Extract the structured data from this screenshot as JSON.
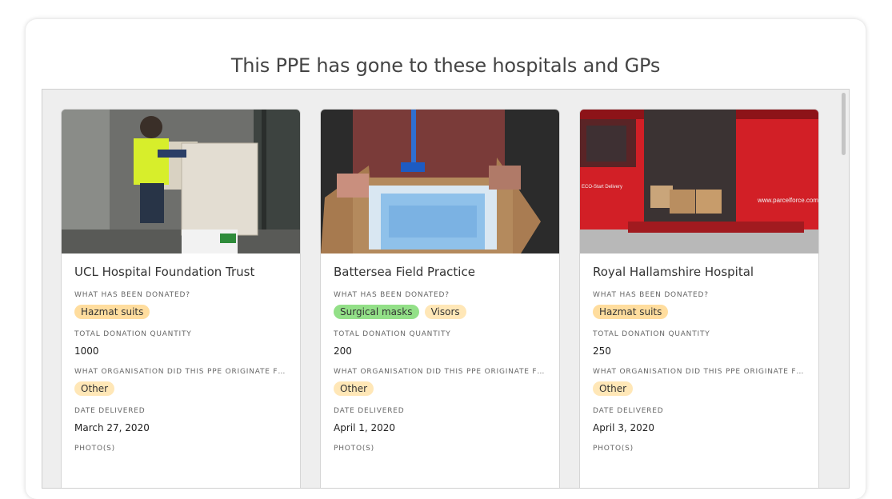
{
  "title": "This PPE has gone to these hospitals and GPs",
  "labels": {
    "donated": "What has been donated?",
    "quantity": "Total donation quantity",
    "organisation": "What organisation did this PPE originate from?",
    "date": "Date delivered",
    "photos": "Photo(s)"
  },
  "cards": [
    {
      "name": "UCL Hospital Foundation Trust",
      "donated": [
        "Hazmat suits"
      ],
      "quantity": "1000",
      "organisation": "Other",
      "date": "March 27, 2020",
      "image": "man-in-hi-vis-vest-loading-boxes"
    },
    {
      "name": "Battersea Field Practice",
      "donated": [
        "Surgical masks",
        "Visors"
      ],
      "quantity": "200",
      "organisation": "Other",
      "date": "April 1, 2020",
      "image": "box-of-surgical-masks"
    },
    {
      "name": "Royal Hallamshire Hospital",
      "donated": [
        "Hazmat suits"
      ],
      "quantity": "250",
      "organisation": "Other",
      "date": "April 3, 2020",
      "image": "red-parcelforce-van-with-boxes",
      "van_text": [
        "ECO-Start Delivery",
        "www.parcelforce.com"
      ]
    }
  ],
  "colors": {
    "hazmat": "#ffdd9e",
    "surgical_masks": "#93e088",
    "visors": "#ffe7b7",
    "other": "#ffe7b7"
  }
}
